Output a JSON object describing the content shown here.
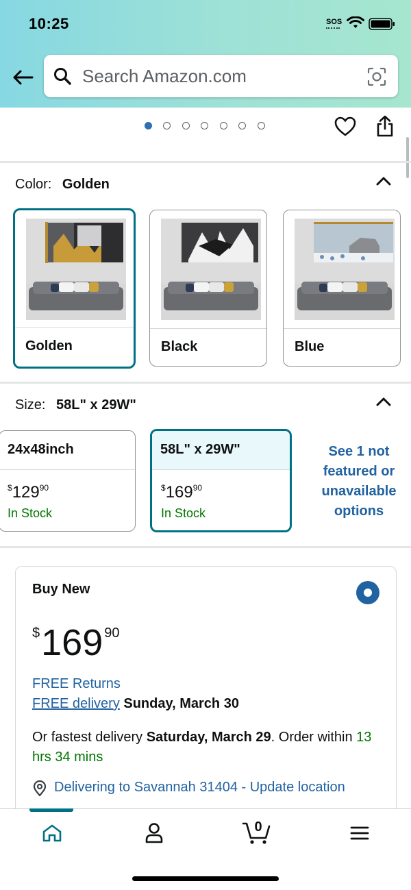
{
  "status_bar": {
    "time": "10:25",
    "sos": "SOS"
  },
  "search": {
    "placeholder": "Search Amazon.com"
  },
  "carousel": {
    "dot_count": 7,
    "active_index": 0
  },
  "color_section": {
    "label": "Color:",
    "selected": "Golden",
    "options": [
      {
        "name": "Golden",
        "selected": true
      },
      {
        "name": "Black",
        "selected": false
      },
      {
        "name": "Blue",
        "selected": false
      }
    ]
  },
  "size_section": {
    "label": "Size:",
    "selected": "58L\" x 29W\"",
    "options": [
      {
        "title": "24x48inch",
        "price_currency": "$",
        "price_whole": "129",
        "price_cents": "90",
        "stock": "In Stock",
        "selected": false
      },
      {
        "title": "58L\" x 29W\"",
        "price_currency": "$",
        "price_whole": "169",
        "price_cents": "90",
        "stock": "In Stock",
        "selected": true
      }
    ],
    "see_more": "See 1 not featured or unavailable options"
  },
  "buy_box": {
    "label": "Buy New",
    "price_currency": "$",
    "price_whole": "169",
    "price_cents": "90",
    "free_returns": "FREE Returns",
    "free_delivery_link": "FREE delivery",
    "free_delivery_date": "Sunday, March 30",
    "fastest_prefix": "Or fastest delivery",
    "fastest_date": "Saturday, March 29",
    "fastest_mid": ". Order within",
    "countdown": "13 hrs 34 mins",
    "location": "Delivering to Savannah 31404 - Update location"
  },
  "bottom_nav": {
    "items": [
      "home-icon",
      "account-icon",
      "cart-icon",
      "menu-icon"
    ],
    "cart_count": "0",
    "active": "home",
    "accent": "#007185"
  },
  "colors": {
    "link": "#2162a1",
    "in_stock": "#007600",
    "selected_border": "#007185"
  }
}
